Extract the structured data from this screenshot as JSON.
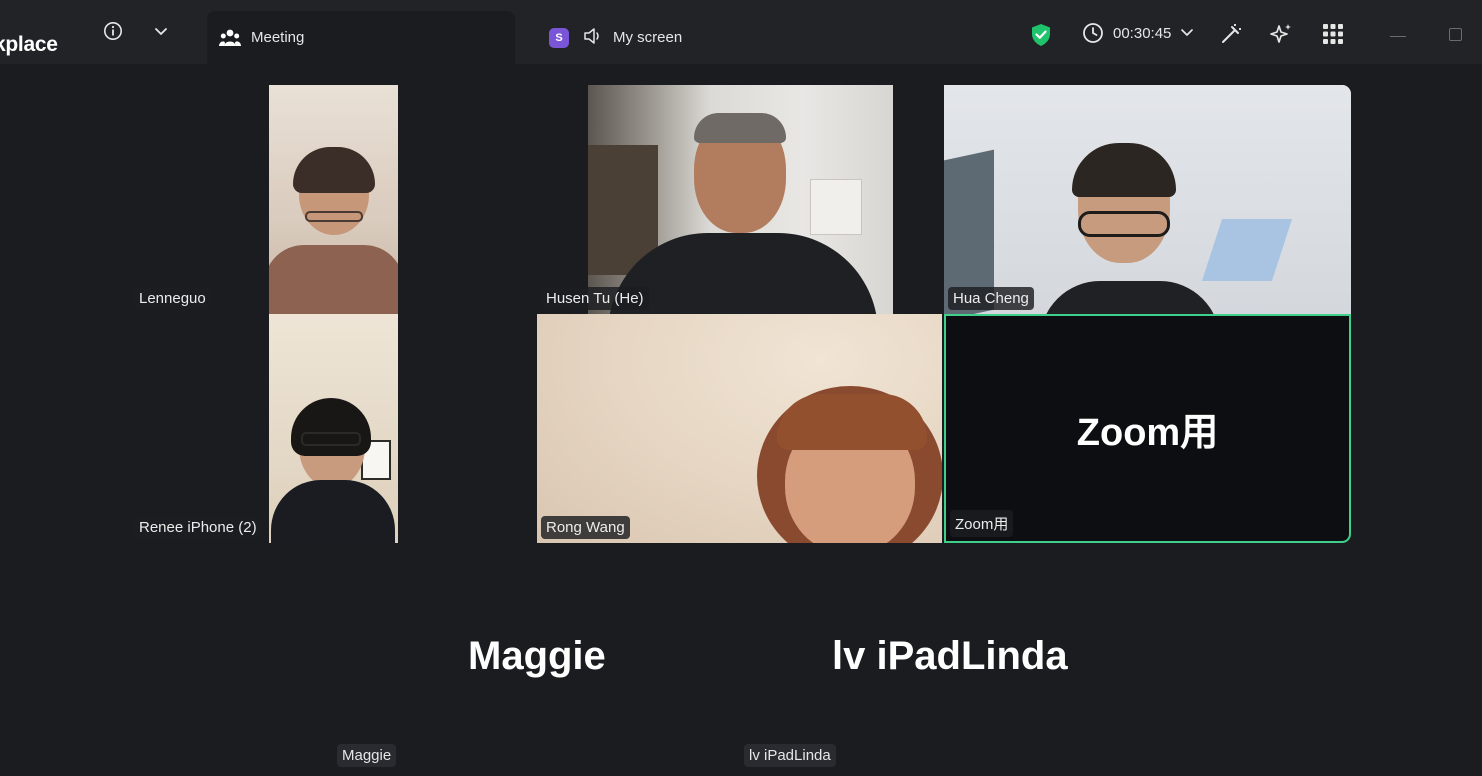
{
  "topbar": {
    "app_name": "kplace",
    "tabs": [
      {
        "label": "Meeting",
        "active": true,
        "icon": "participants-icon"
      },
      {
        "label": "My screen",
        "active": false,
        "badge": "S",
        "icon": "speaker-icon"
      }
    ],
    "timer": "00:30:45"
  },
  "colors": {
    "active_speaker_border": "#3ed08a",
    "badge_purple": "#7a55d8",
    "shield_green": "#1fc36b"
  },
  "tiles": [
    {
      "name": "Lenneguo"
    },
    {
      "name": "Husen Tu (He)"
    },
    {
      "name": "Hua Cheng"
    },
    {
      "name": "Renee iPhone (2)"
    },
    {
      "name": "Rong Wang"
    },
    {
      "name": "Zoom用",
      "big_label": "Zoom用"
    }
  ],
  "audio_only": [
    {
      "big_label": "Maggie",
      "tag": "Maggie"
    },
    {
      "big_label": "lv iPadLinda",
      "tag": "lv iPadLinda"
    }
  ]
}
